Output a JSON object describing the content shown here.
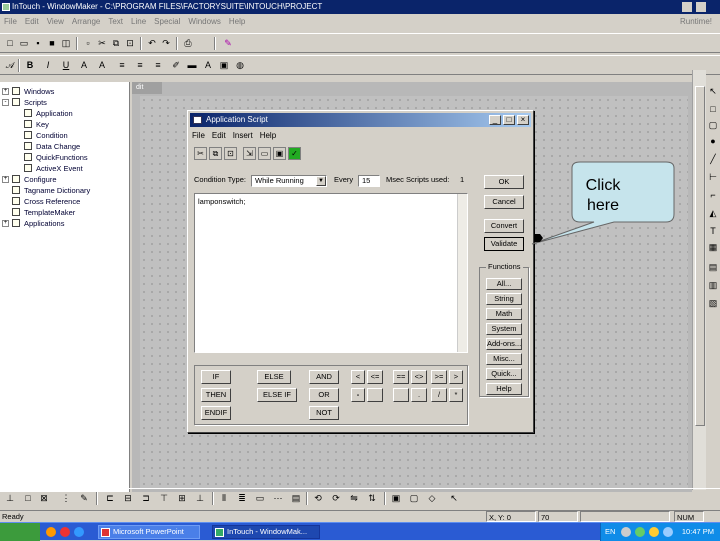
{
  "window": {
    "title": "InTouch - WindowMaker - C:\\PROGRAM FILES\\FACTORYSUITE\\INTOUCH\\PROJECT",
    "menu": [
      "File",
      "Edit",
      "View",
      "Arrange",
      "Text",
      "Line",
      "Special",
      "Windows",
      "Help"
    ],
    "menu_right": "Runtime!"
  },
  "tree": {
    "items": [
      {
        "label": "Windows",
        "level": 0,
        "expander": "+"
      },
      {
        "label": "Scripts",
        "level": 0,
        "expander": "-"
      },
      {
        "label": "Application",
        "level": 1
      },
      {
        "label": "Key",
        "level": 1
      },
      {
        "label": "Condition",
        "level": 1
      },
      {
        "label": "Data Change",
        "level": 1
      },
      {
        "label": "QuickFunctions",
        "level": 1
      },
      {
        "label": "ActiveX Event",
        "level": 1
      },
      {
        "label": "Configure",
        "level": 0,
        "expander": "+"
      },
      {
        "label": "Tagname Dictionary",
        "level": 0
      },
      {
        "label": "Cross Reference",
        "level": 0
      },
      {
        "label": "TemplateMaker",
        "level": 0
      },
      {
        "label": "Applications",
        "level": 0,
        "expander": "+"
      }
    ]
  },
  "workspace": {
    "tab_label": "dit"
  },
  "dialog": {
    "title": "Application Script",
    "menu": [
      "File",
      "Edit",
      "Insert",
      "Help"
    ],
    "condition_type_label": "Condition Type:",
    "condition_type_value": "While Running",
    "every_label": "Every",
    "every_value": "15",
    "msec_label": "Msec",
    "scripts_used_label": "Scripts used:",
    "scripts_used_value": "1",
    "script_text": "lamponswitch;",
    "buttons": {
      "ok": "OK",
      "cancel": "Cancel",
      "convert": "Convert",
      "validate": "Validate"
    },
    "functions_title": "Functions",
    "functions": [
      "All...",
      "String",
      "Math",
      "System",
      "Add-ons...",
      "Misc...",
      "Quick...",
      "Help"
    ],
    "keypad": {
      "if": "IF",
      "then": "THEN",
      "endif": "ENDIF",
      "else": "ELSE",
      "elseif": "ELSE IF",
      "and": "AND",
      "or": "OR",
      "not": "NOT",
      "lt": "<",
      "le": "<=",
      "eq": "==",
      "ge": ">=",
      "gt": ">",
      "minus": "-",
      "plus": "+",
      "mul": "*",
      "div": "/",
      "dot": "."
    }
  },
  "callout": {
    "line1": "Click",
    "line2": "here"
  },
  "statusbar": {
    "status": "Ready",
    "coords": "X, Y: 0",
    "extra": "70",
    "num": "NUM"
  },
  "taskbar": {
    "tasks": [
      {
        "label": "Microsoft PowerPoint",
        "active": false
      },
      {
        "label": "InTouch - WindowMak...",
        "active": true
      }
    ],
    "lang": "EN",
    "clock": "10:47 PM"
  }
}
